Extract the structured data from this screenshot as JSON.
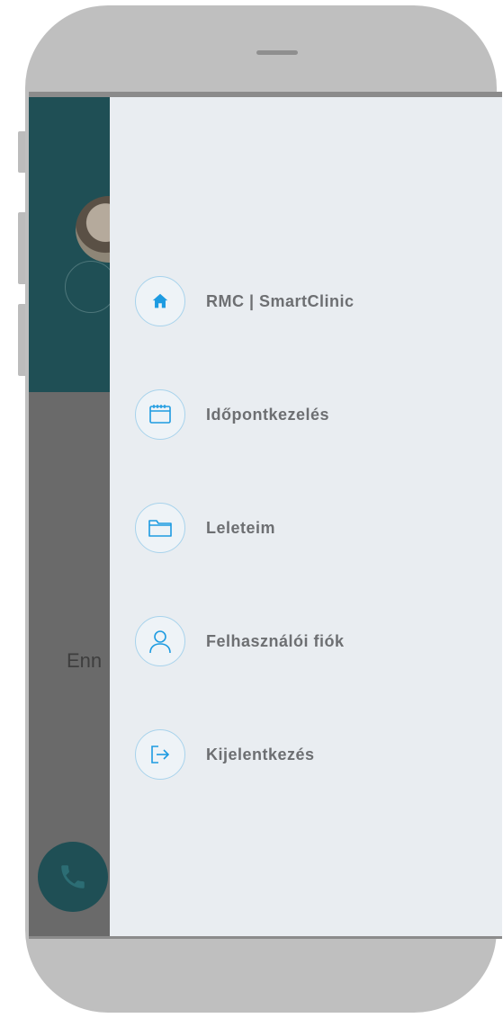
{
  "background_app": {
    "partial_text": "Enn"
  },
  "drawer": {
    "items": [
      {
        "label": "RMC | SmartClinic",
        "icon": "home-icon"
      },
      {
        "label": "Időpontkezelés",
        "icon": "calendar-icon"
      },
      {
        "label": "Leleteim",
        "icon": "folder-icon"
      },
      {
        "label": "Felhasználói fiók",
        "icon": "user-icon"
      },
      {
        "label": "Kijelentkezés",
        "icon": "logout-icon"
      }
    ]
  },
  "colors": {
    "accent": "#1d9be1",
    "header_teal": "#1f4f55",
    "drawer_bg": "#e9edf1"
  }
}
